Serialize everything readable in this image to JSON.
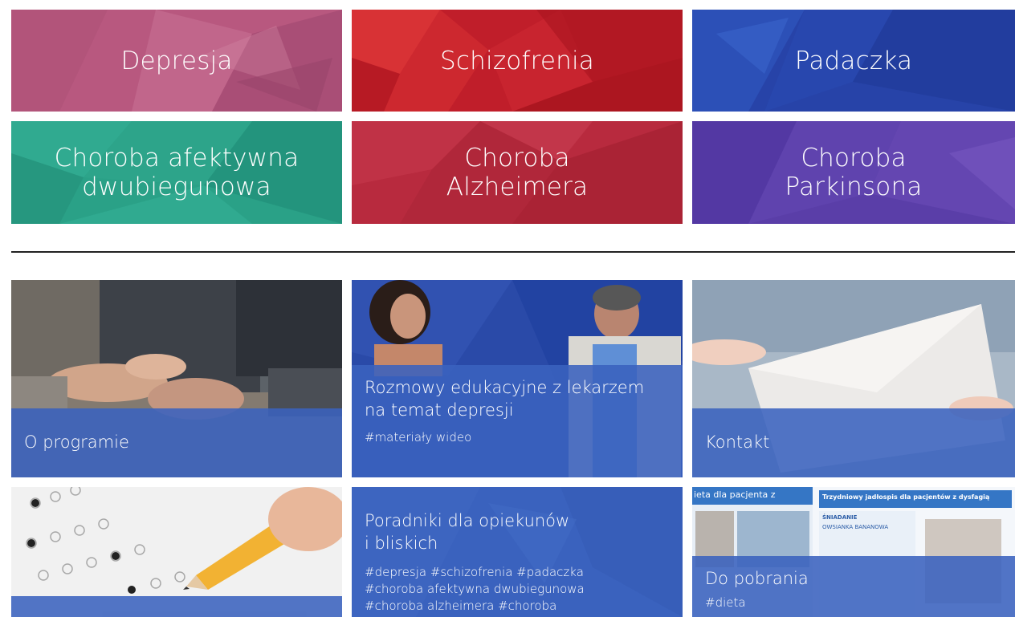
{
  "conditions": {
    "items": [
      {
        "label": "Depresja",
        "color": "#b8587f"
      },
      {
        "label": "Schizofrenia",
        "color": "#c01e2a"
      },
      {
        "label": "Padaczka",
        "color": "#2743a8"
      },
      {
        "label": "Choroba afektywna\ndwubiegunowa",
        "color": "#2aa187"
      },
      {
        "label": "Choroba\nAlzheimera",
        "color": "#b82a3e"
      },
      {
        "label": "Choroba\nParkinsona",
        "color": "#5a3ea8"
      }
    ]
  },
  "cards": {
    "o_programie": {
      "title": "O programie"
    },
    "rozmowy": {
      "title": "Rozmowy edukacyjne z lekarzem\nna temat depresji",
      "tags": "#materiały wideo"
    },
    "kontakt": {
      "title": "Kontakt"
    },
    "poradniki": {
      "title": "Poradniki dla opiekunów\ni bliskich",
      "tags": "#depresja #schizofrenia #padaczka\n#choroba afektywna dwubiegunowa\n#choroba alzheimera #choroba"
    },
    "do_pobrania": {
      "title": "Do pobrania",
      "tags": "#dieta",
      "doc_left_text": "ieta dla pacjenta z",
      "doc_right_text": "Trzydniowy jadłospis dla pacjentów z dysfagią",
      "doc_right_subtitle": "ŚNIADANIE",
      "doc_right_item": "OWSIANKA BANANOWA"
    },
    "test": {}
  },
  "colors": {
    "band": "#3a62be",
    "divider": "#222222"
  }
}
